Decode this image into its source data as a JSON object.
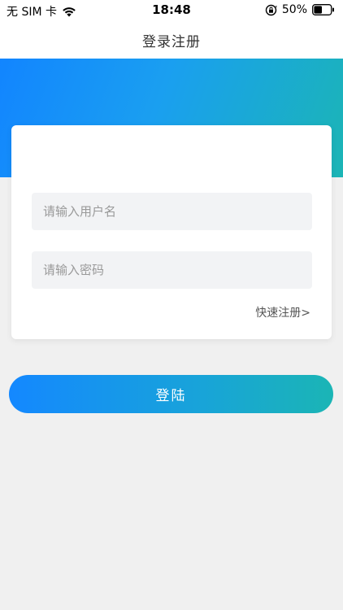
{
  "status_bar": {
    "carrier": "无 SIM 卡",
    "time": "18:48",
    "battery_percent": "50%",
    "battery_level": 0.5,
    "icons": [
      "wifi-icon",
      "rotation-lock-icon",
      "battery-icon"
    ]
  },
  "nav": {
    "title": "登录注册"
  },
  "login_form": {
    "username_placeholder": "请输入用户名",
    "username_value": "",
    "password_placeholder": "请输入密码",
    "password_value": "",
    "register_link": "快速注册>",
    "login_button": "登陆"
  },
  "colors": {
    "gradient_start": "#1285ff",
    "gradient_end": "#1bb5b5",
    "background": "#f0f0f0",
    "input_background": "#f2f3f5"
  }
}
